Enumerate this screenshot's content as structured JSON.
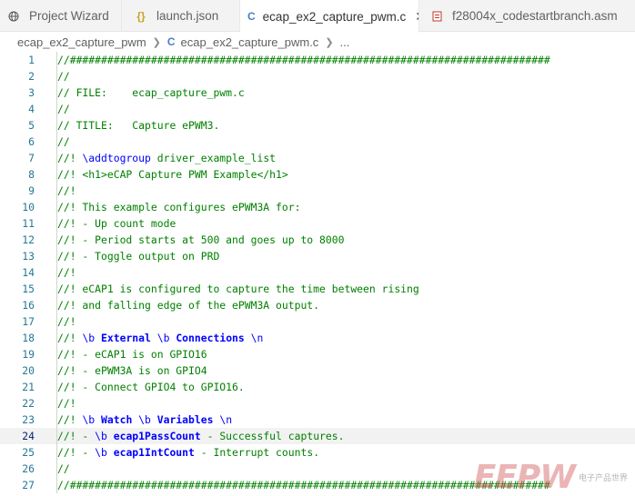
{
  "tabs": [
    {
      "label": "Project Wizard",
      "icon": "globe-icon"
    },
    {
      "label": "launch.json",
      "icon": "json-braces-icon"
    },
    {
      "label": "ecap_ex2_capture_pwm.c",
      "icon": "c-file-icon",
      "active": true
    },
    {
      "label": "f28004x_codestartbranch.asm",
      "icon": "asm-file-icon"
    }
  ],
  "breadcrumb": {
    "folder": "ecap_ex2_capture_pwm",
    "file": "ecap_ex2_capture_pwm.c",
    "more": "..."
  },
  "lines": [
    {
      "n": "1",
      "text": "//#############################################################################"
    },
    {
      "n": "2",
      "text": "//"
    },
    {
      "n": "3",
      "text": "// FILE:    ecap_capture_pwm.c"
    },
    {
      "n": "4",
      "text": "//"
    },
    {
      "n": "5",
      "text": "// TITLE:   Capture ePWM3."
    },
    {
      "n": "6",
      "text": "//"
    },
    {
      "n": "7",
      "pre": "//! ",
      "kw": "\\addtogroup",
      "post": " driver_example_list"
    },
    {
      "n": "8",
      "text": "//! <h1>eCAP Capture PWM Example</h1>"
    },
    {
      "n": "9",
      "text": "//!"
    },
    {
      "n": "10",
      "text": "//! This example configures ePWM3A for:"
    },
    {
      "n": "11",
      "text": "//! - Up count mode"
    },
    {
      "n": "12",
      "text": "//! - Period starts at 500 and goes up to 8000"
    },
    {
      "n": "13",
      "text": "//! - Toggle output on PRD"
    },
    {
      "n": "14",
      "text": "//!"
    },
    {
      "n": "15",
      "text": "//! eCAP1 is configured to capture the time between rising"
    },
    {
      "n": "16",
      "text": "//! and falling edge of the ePWM3A output."
    },
    {
      "n": "17",
      "text": "//!"
    },
    {
      "n": "18",
      "doc": [
        "//! ",
        "\\b",
        " ",
        "External",
        " ",
        "\\b",
        " ",
        "Connections",
        " ",
        "\\n",
        ""
      ]
    },
    {
      "n": "19",
      "text": "//! - eCAP1 is on GPIO16"
    },
    {
      "n": "20",
      "text": "//! - ePWM3A is on GPIO4"
    },
    {
      "n": "21",
      "text": "//! - Connect GPIO4 to GPIO16."
    },
    {
      "n": "22",
      "text": "//!"
    },
    {
      "n": "23",
      "doc": [
        "//! ",
        "\\b",
        " ",
        "Watch",
        " ",
        "\\b",
        " ",
        "Variables",
        " ",
        "\\n",
        ""
      ]
    },
    {
      "n": "24",
      "doc2": [
        "//! - ",
        "\\b",
        " ",
        "ecap1PassCount",
        " - Successful captures."
      ],
      "current": true
    },
    {
      "n": "25",
      "doc2": [
        "//! - ",
        "\\b",
        " ",
        "ecap1IntCount",
        " - Interrupt counts."
      ]
    },
    {
      "n": "26",
      "text": "//"
    },
    {
      "n": "27",
      "text": "//#############################################################################"
    }
  ],
  "watermark": {
    "logo": "EEPW",
    "sub": "电子产品世界"
  },
  "colors": {
    "comment": "#008000",
    "keyword": "#0000ff",
    "line_number": "#237893",
    "tab_bar": "#f3f3f3"
  }
}
